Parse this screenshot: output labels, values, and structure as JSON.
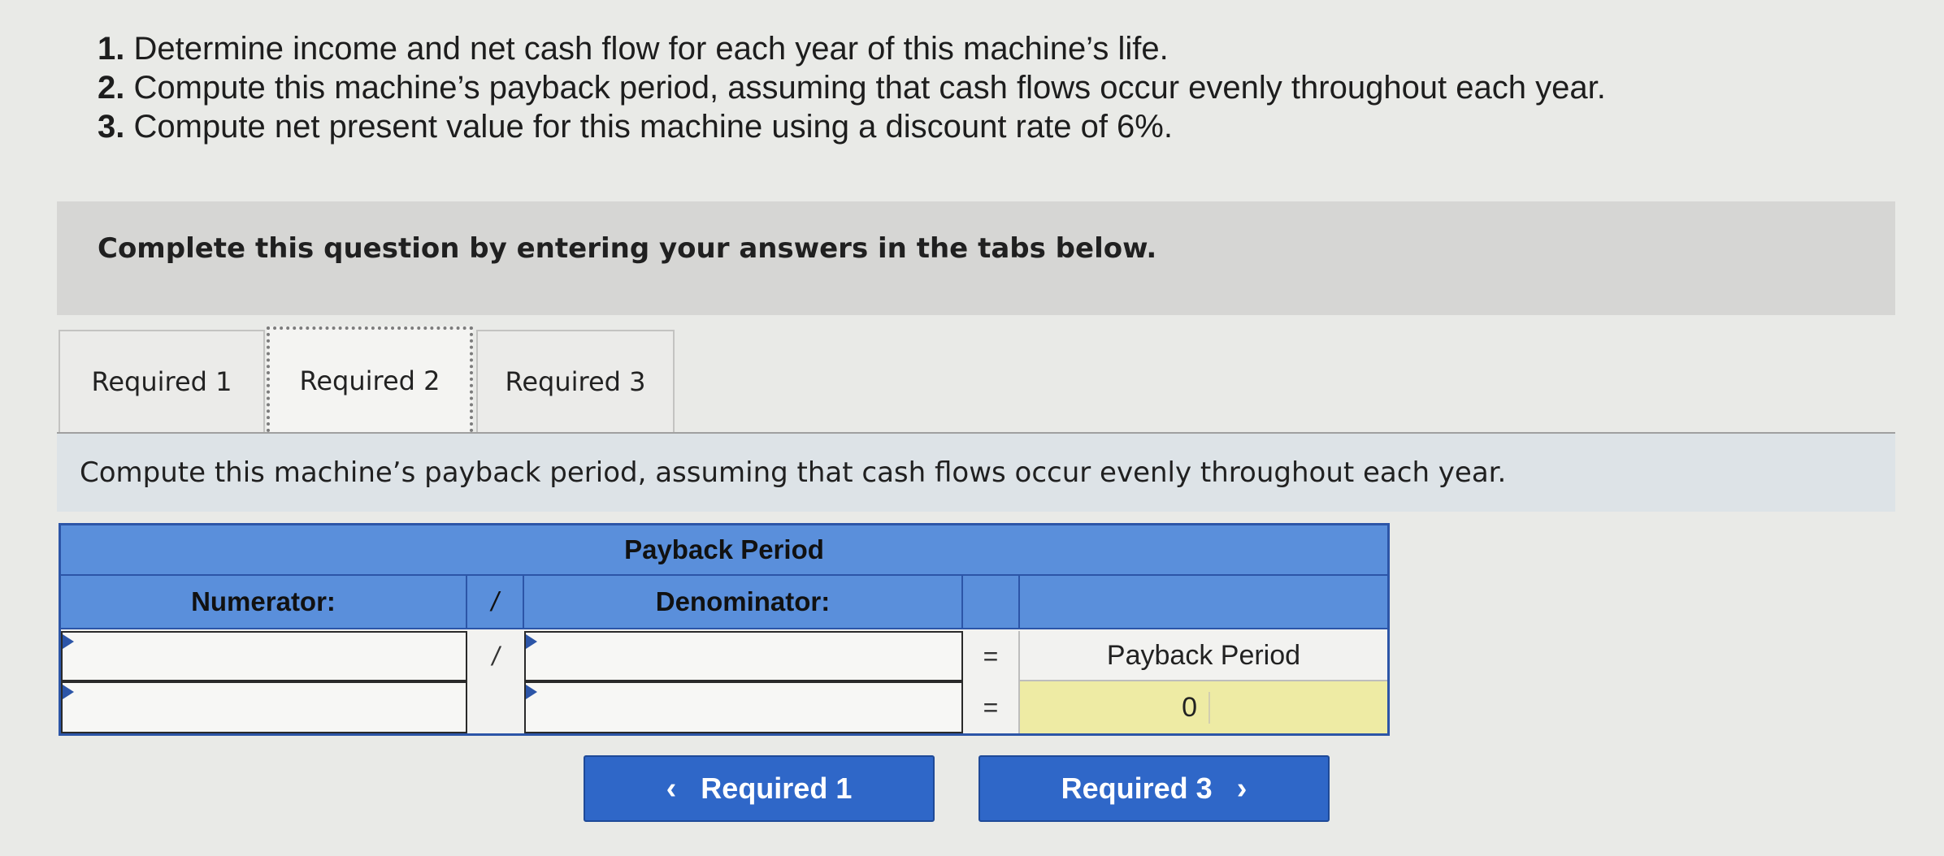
{
  "instructions": [
    {
      "num": "1.",
      "text": "Determine income and net cash flow for each year of this machine’s life."
    },
    {
      "num": "2.",
      "text": "Compute this machine’s payback period, assuming that cash flows occur evenly throughout each year."
    },
    {
      "num": "3.",
      "text": "Compute net present value for this machine using a discount rate of 6%."
    }
  ],
  "banner": "Complete this question by entering your answers in the tabs below.",
  "tabs": [
    {
      "label": "Required 1",
      "active": false
    },
    {
      "label": "Required 2",
      "active": true
    },
    {
      "label": "Required 3",
      "active": false
    }
  ],
  "prompt": "Compute this machine’s payback period, assuming that cash flows occur evenly throughout each year.",
  "table": {
    "title": "Payback Period",
    "numerator_label": "Numerator:",
    "divider": "/",
    "denominator_label": "Denominator:",
    "equals": "=",
    "result_label": "Payback Period",
    "rows": [
      {
        "numerator": "",
        "divider": "/",
        "denominator": "",
        "equals": "=",
        "result": "Payback Period"
      },
      {
        "numerator": "",
        "divider": "",
        "denominator": "",
        "equals": "=",
        "result": "0"
      }
    ]
  },
  "nav": {
    "prev_label": "Required 1",
    "prev_icon": "‹",
    "next_label": "Required 3",
    "next_icon": "›"
  },
  "colors": {
    "header_blue": "#5a8fdb",
    "button_blue": "#2f67c8",
    "result_yellow": "#eeeba4"
  }
}
